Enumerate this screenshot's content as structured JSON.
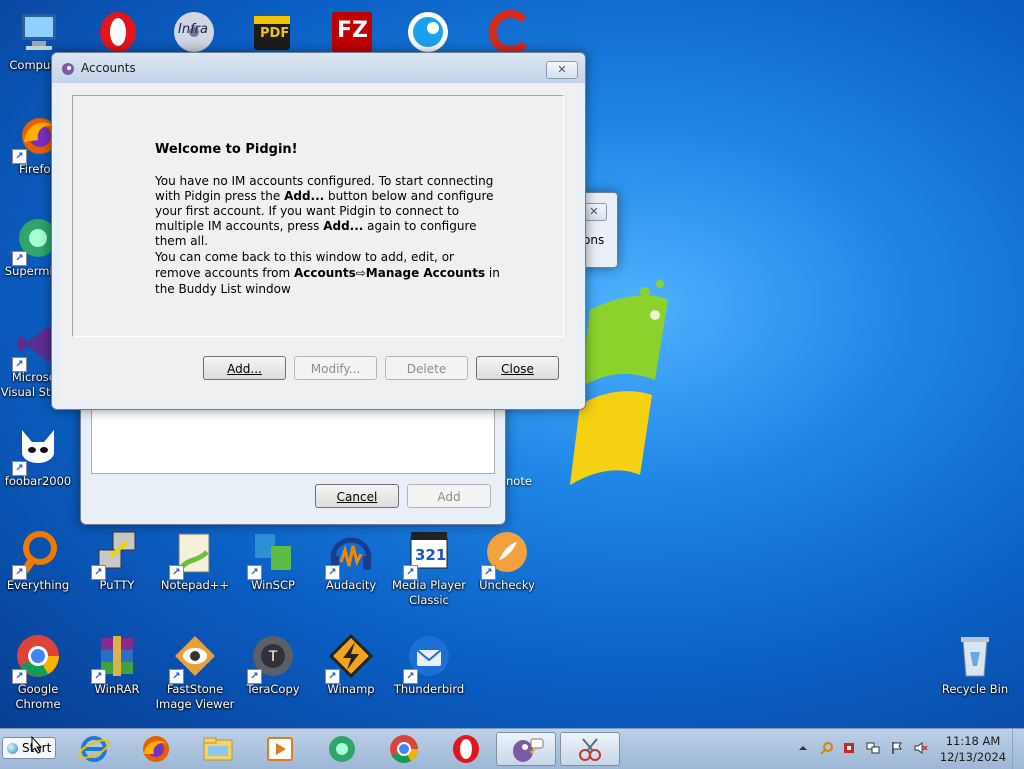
{
  "desktop": {
    "icons": {
      "computer": "Computer",
      "firefox": "Firefox",
      "supermium": "Supermium",
      "visual_studio": "Microsoft Visual Studio",
      "foobar": "foobar2000",
      "everything": "Everything",
      "putty": "PuTTY",
      "notepadpp": "Notepad++",
      "winscp": "WinSCP",
      "audacity": "Audacity",
      "mpc": "Media Player Classic",
      "unchecky": "Unchecky",
      "chrome": "Google Chrome",
      "winrar": "WinRAR",
      "faststone": "FastStone Image Viewer",
      "teracopy": "TeraCopy",
      "winamp": "Winamp",
      "thunderbird": "Thunderbird",
      "recycle": "Recycle Bin",
      "partial_note": "note",
      "opera_top": "",
      "infra": "Infra",
      "pdf": "PDF",
      "filezilla": "FZ"
    },
    "mpc_number": "321"
  },
  "bg_window": {
    "visible_text": "ons",
    "close_glyph": "✕"
  },
  "add_account_window": {
    "cancel_label": "Cancel",
    "add_label": "Add"
  },
  "accounts_window": {
    "title": "Accounts",
    "close_glyph": "✕",
    "welcome_heading": "Welcome to Pidgin!",
    "p1": {
      "t1": "You have no IM accounts configured. To start connecting with Pidgin press the ",
      "b1": "Add...",
      "t2": " button below and configure your first account. If you want Pidgin to connect to multiple IM accounts, press ",
      "b2": "Add...",
      "t3": " again to configure them all."
    },
    "p2": {
      "t1": "You can come back to this window to add, edit, or remove accounts from ",
      "b1": "Accounts",
      "arrow": "⇨",
      "b2": "Manage Accounts",
      "t2": " in the Buddy List window"
    },
    "buttons": {
      "add": "Add...",
      "modify": "Modify...",
      "delete": "Delete",
      "close": "Close"
    }
  },
  "taskbar": {
    "start_label": "Start",
    "clock_time": "11:18 AM",
    "clock_date": "12/13/2024",
    "icons": [
      "internet-explorer-icon",
      "firefox-icon",
      "file-explorer-icon",
      "media-player-icon",
      "supermium-icon",
      "chrome-icon",
      "opera-icon",
      "pidgin-icon",
      "snipping-tool-icon"
    ],
    "tray_icons": [
      "show-hidden-icons-arrow-icon",
      "search-tray-icon",
      "security-tray-icon",
      "network-tray-icon",
      "action-center-flag-icon",
      "volume-muted-icon"
    ]
  },
  "colors": {
    "desktop_blue": "#0b5fc4",
    "window_frame": "#e9eff6",
    "dialog_bg": "#f0f0f0",
    "taskbar": "#b4cbe5"
  }
}
